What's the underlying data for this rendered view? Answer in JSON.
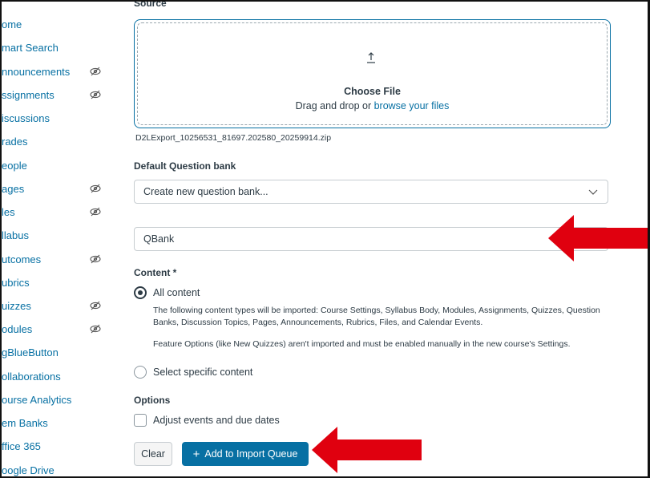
{
  "sidebar": {
    "items": [
      {
        "label": "ome",
        "hidden": false
      },
      {
        "label": "mart Search",
        "hidden": false
      },
      {
        "label": "nnouncements",
        "hidden": true
      },
      {
        "label": "ssignments",
        "hidden": true
      },
      {
        "label": "iscussions",
        "hidden": false
      },
      {
        "label": "rades",
        "hidden": false
      },
      {
        "label": "eople",
        "hidden": false
      },
      {
        "label": "ages",
        "hidden": true
      },
      {
        "label": "les",
        "hidden": true
      },
      {
        "label": "llabus",
        "hidden": false
      },
      {
        "label": "utcomes",
        "hidden": true
      },
      {
        "label": "ubrics",
        "hidden": false
      },
      {
        "label": "uizzes",
        "hidden": true
      },
      {
        "label": "odules",
        "hidden": true
      },
      {
        "label": "gBlueButton",
        "hidden": false
      },
      {
        "label": "ollaborations",
        "hidden": false
      },
      {
        "label": "ourse Analytics",
        "hidden": false
      },
      {
        "label": "em Banks",
        "hidden": false
      },
      {
        "label": "ffice 365",
        "hidden": false
      },
      {
        "label": "oogle Drive",
        "hidden": false
      }
    ],
    "hidden_icon": "eye-slash-icon"
  },
  "source": {
    "label": "Source",
    "choose_file": "Choose File",
    "drag_text": "Drag and drop or ",
    "browse_link": "browse your files",
    "filename": "D2LExport_10256531_81697.202580_20259914.zip"
  },
  "question_bank": {
    "label": "Default Question bank",
    "selected": "Create new question bank...",
    "name_value": "QBank"
  },
  "content": {
    "label": "Content *",
    "all_content_label": "All content",
    "all_content_checked": true,
    "description_1": "The following content types will be imported: Course Settings, Syllabus Body, Modules, Assignments, Quizzes, Question Banks, Discussion Topics, Pages, Announcements, Rubrics, Files, and Calendar Events.",
    "description_2": "Feature Options (like New Quizzes) aren't imported and must be enabled manually in the new course's Settings.",
    "specific_label": "Select specific content",
    "specific_checked": false
  },
  "options": {
    "label": "Options",
    "adjust_dates_label": "Adjust events and due dates",
    "adjust_dates_checked": false
  },
  "buttons": {
    "clear": "Clear",
    "add_plus": "+",
    "add": "Add to Import Queue"
  },
  "colors": {
    "link": "#0770a3",
    "primary": "#0770a3",
    "text": "#2d3b45",
    "annotation_arrow": "#e0000f"
  }
}
